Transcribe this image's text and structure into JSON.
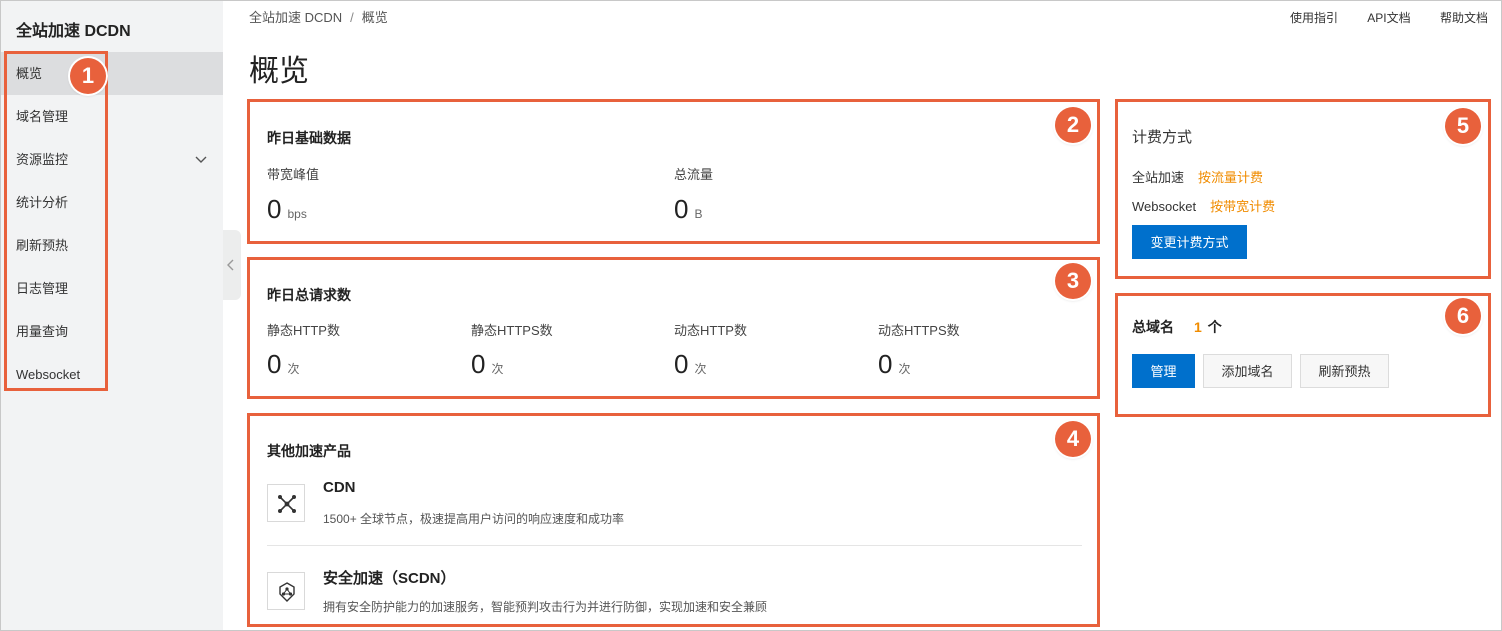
{
  "sidebar": {
    "brand": "全站加速 DCDN",
    "items": [
      {
        "label": "概览"
      },
      {
        "label": "域名管理"
      },
      {
        "label": "资源监控"
      },
      {
        "label": "统计分析"
      },
      {
        "label": "刷新预热"
      },
      {
        "label": "日志管理"
      },
      {
        "label": "用量查询"
      },
      {
        "label": "Websocket"
      }
    ]
  },
  "breadcrumb": {
    "root": "全站加速 DCDN",
    "sep": "/",
    "current": "概览"
  },
  "top_links": [
    "使用指引",
    "API文档",
    "帮助文档"
  ],
  "page_title": "概览",
  "basic": {
    "title": "昨日基础数据",
    "bandwidth": {
      "label": "带宽峰值",
      "value": "0",
      "unit": "bps"
    },
    "traffic": {
      "label": "总流量",
      "value": "0",
      "unit": "B"
    }
  },
  "requests": {
    "title": "昨日总请求数",
    "items": [
      {
        "label": "静态HTTP数",
        "value": "0",
        "unit": "次"
      },
      {
        "label": "静态HTTPS数",
        "value": "0",
        "unit": "次"
      },
      {
        "label": "动态HTTP数",
        "value": "0",
        "unit": "次"
      },
      {
        "label": "动态HTTPS数",
        "value": "0",
        "unit": "次"
      }
    ]
  },
  "products": {
    "title": "其他加速产品",
    "items": [
      {
        "name": "CDN",
        "desc": "1500+ 全球节点，极速提高用户访问的响应速度和成功率",
        "icon": "network-nodes-icon"
      },
      {
        "name": "安全加速（SCDN）",
        "desc": "拥有安全防护能力的加速服务，智能预判攻击行为并进行防御，实现加速和安全兼顾",
        "icon": "shield-nodes-icon"
      }
    ]
  },
  "billing": {
    "title": "计费方式",
    "rows": [
      {
        "label": "全站加速",
        "value": "按流量计费"
      },
      {
        "label": "Websocket",
        "value": "按带宽计费"
      }
    ],
    "change_button": "变更计费方式"
  },
  "domains": {
    "title": "总域名",
    "count": "1",
    "unit": "个",
    "buttons": [
      "管理",
      "添加域名",
      "刷新预热"
    ]
  },
  "badges": [
    "1",
    "2",
    "3",
    "4",
    "5",
    "6"
  ],
  "colors": {
    "accent": "#0070cc",
    "highlight": "#e8613c",
    "orange": "#f08c00"
  }
}
